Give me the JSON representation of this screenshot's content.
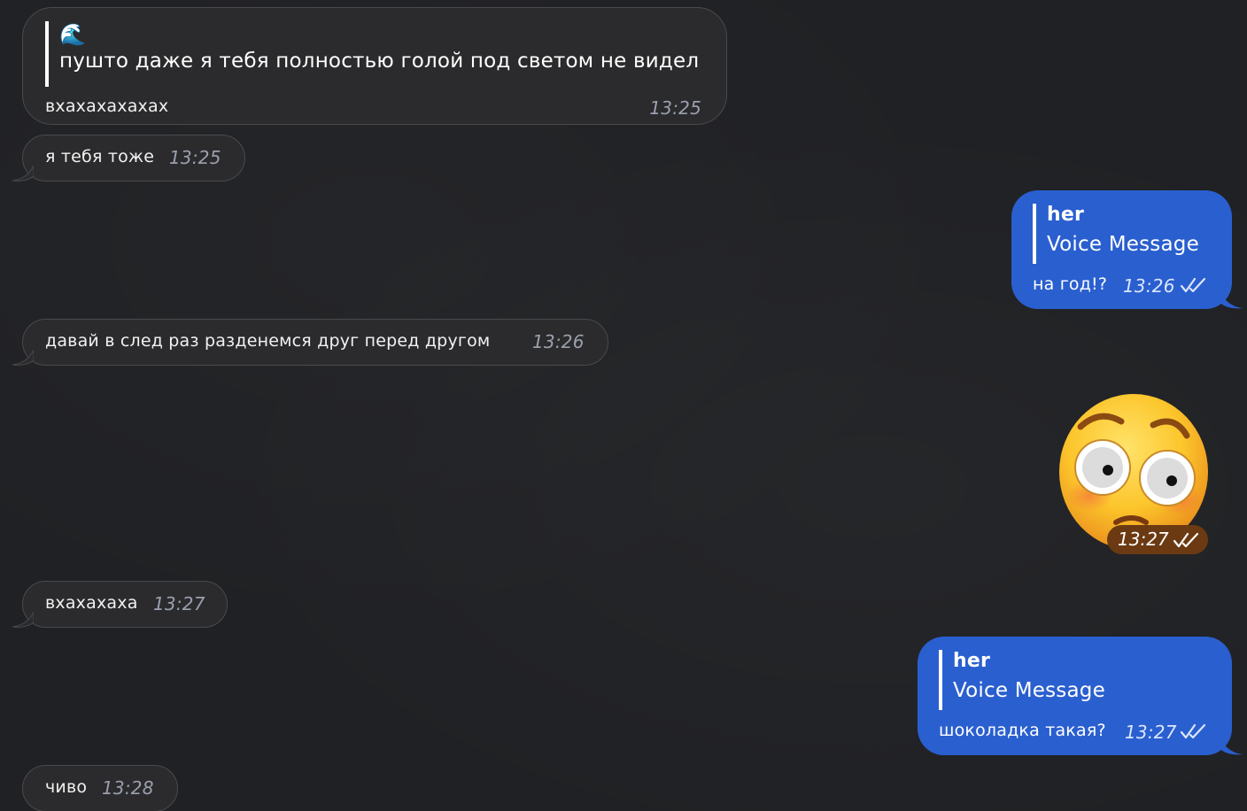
{
  "messages": [
    {
      "id": "m1",
      "direction": "incoming",
      "reply": {
        "emoji": "🌊",
        "text": "пушто даже я тебя полностью голой под светом не видел"
      },
      "text": "вхахахахахах",
      "time": "13:25"
    },
    {
      "id": "m2",
      "direction": "incoming",
      "text": "я тебя тоже",
      "time": "13:25"
    },
    {
      "id": "m3",
      "direction": "outgoing",
      "reply": {
        "name": "her",
        "text": "Voice Message"
      },
      "text": "на год!?",
      "time": "13:26",
      "status": "read"
    },
    {
      "id": "m4",
      "direction": "incoming",
      "text": "давай в след раз разденемся друг перед другом",
      "time": "13:26"
    },
    {
      "id": "m5",
      "direction": "outgoing",
      "sticker": "flushed-face-emoji",
      "time": "13:27",
      "status": "read"
    },
    {
      "id": "m6",
      "direction": "incoming",
      "text": "вхахахаха",
      "time": "13:27"
    },
    {
      "id": "m7",
      "direction": "outgoing",
      "reply": {
        "name": "her",
        "text": "Voice Message"
      },
      "text": "шоколадка такая?",
      "time": "13:27",
      "status": "read"
    },
    {
      "id": "m8",
      "direction": "incoming",
      "text": "чиво",
      "time": "13:28"
    }
  ],
  "colors": {
    "background": "#202124",
    "incoming_bubble": "#2b2b2d",
    "outgoing_bubble": "#2a5fcf",
    "sticker_time_badge": "#6b3a12"
  }
}
